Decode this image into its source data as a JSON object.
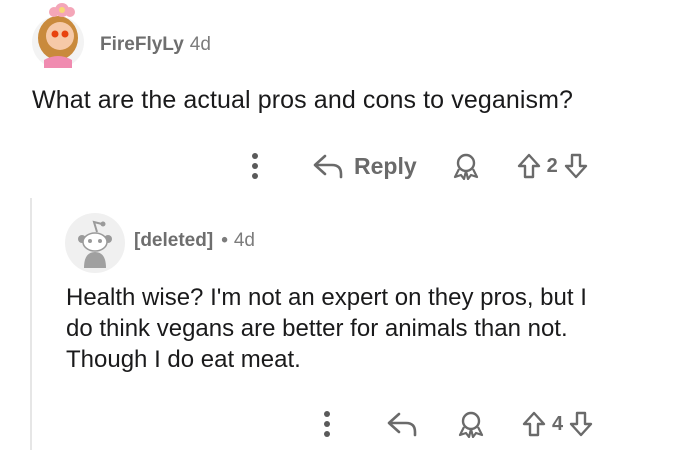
{
  "parent_comment": {
    "username": "FireFlyLy",
    "age": "4d",
    "body": "What are the actual pros and cons to veganism?",
    "actions": {
      "reply_label": "Reply",
      "vote_count": "2"
    }
  },
  "reply_comment": {
    "username": "[deleted]",
    "separator": "•",
    "age": "4d",
    "body_lines": [
      "Health wise? I'm not an expert on they pros, but I",
      "do think vegans are better for animals than not.",
      "Though I do eat meat."
    ],
    "actions": {
      "vote_count": "4"
    }
  },
  "colors": {
    "text": "#1a1a1b",
    "meta": "#7c7c7c",
    "icon": "#6a6a6a",
    "thread_line": "#e6e6e6"
  }
}
